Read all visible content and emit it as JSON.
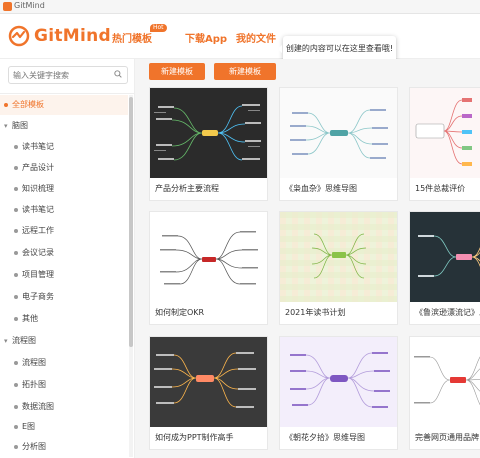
{
  "window": {
    "title": "GitMind"
  },
  "header": {
    "logo_text": "GitMind",
    "nav": {
      "hot_templates": "热门模板",
      "hot_badge": "Hot",
      "download_app": "下载App",
      "my_files": "我的文件"
    },
    "tooltip": "创建的内容可以在这里查看哦!"
  },
  "sidebar": {
    "search_placeholder": "输入关键字搜索",
    "items": [
      {
        "label": "全部模板",
        "active": true
      },
      {
        "label": "脑图",
        "group": true
      },
      {
        "label": "读书笔记"
      },
      {
        "label": "产品设计"
      },
      {
        "label": "知识梳理"
      },
      {
        "label": "读书笔记"
      },
      {
        "label": "远程工作"
      },
      {
        "label": "会议记录"
      },
      {
        "label": "项目管理"
      },
      {
        "label": "电子商务"
      },
      {
        "label": "其他"
      },
      {
        "label": "流程图",
        "group": true
      },
      {
        "label": "流程图"
      },
      {
        "label": "拓扑图"
      },
      {
        "label": "数据流图"
      },
      {
        "label": "E图"
      },
      {
        "label": "分析图"
      }
    ]
  },
  "toolbar": {
    "new_button": "新建模板",
    "new_template_button": "新建模板"
  },
  "templates": [
    {
      "title": "产品分析主要流程",
      "theme": "dark"
    },
    {
      "title": "《枭血杂》思维导图",
      "theme": "light"
    },
    {
      "title": "15件总裁评价",
      "theme": "light"
    },
    {
      "title": "如何制定OKR",
      "theme": "white"
    },
    {
      "title": "2021年读书计划",
      "theme": "grid"
    },
    {
      "title": "《鲁滨逊漂流记》思",
      "theme": "navy"
    },
    {
      "title": "如何成为PPT制作高手",
      "theme": "dark"
    },
    {
      "title": "《朝花夕拾》思维导图",
      "theme": "lavender"
    },
    {
      "title": "完善网页通用品牌",
      "theme": "white"
    }
  ],
  "colors": {
    "accent": "#f0742b",
    "sidebar_active_bg": "#fdf3ec"
  }
}
